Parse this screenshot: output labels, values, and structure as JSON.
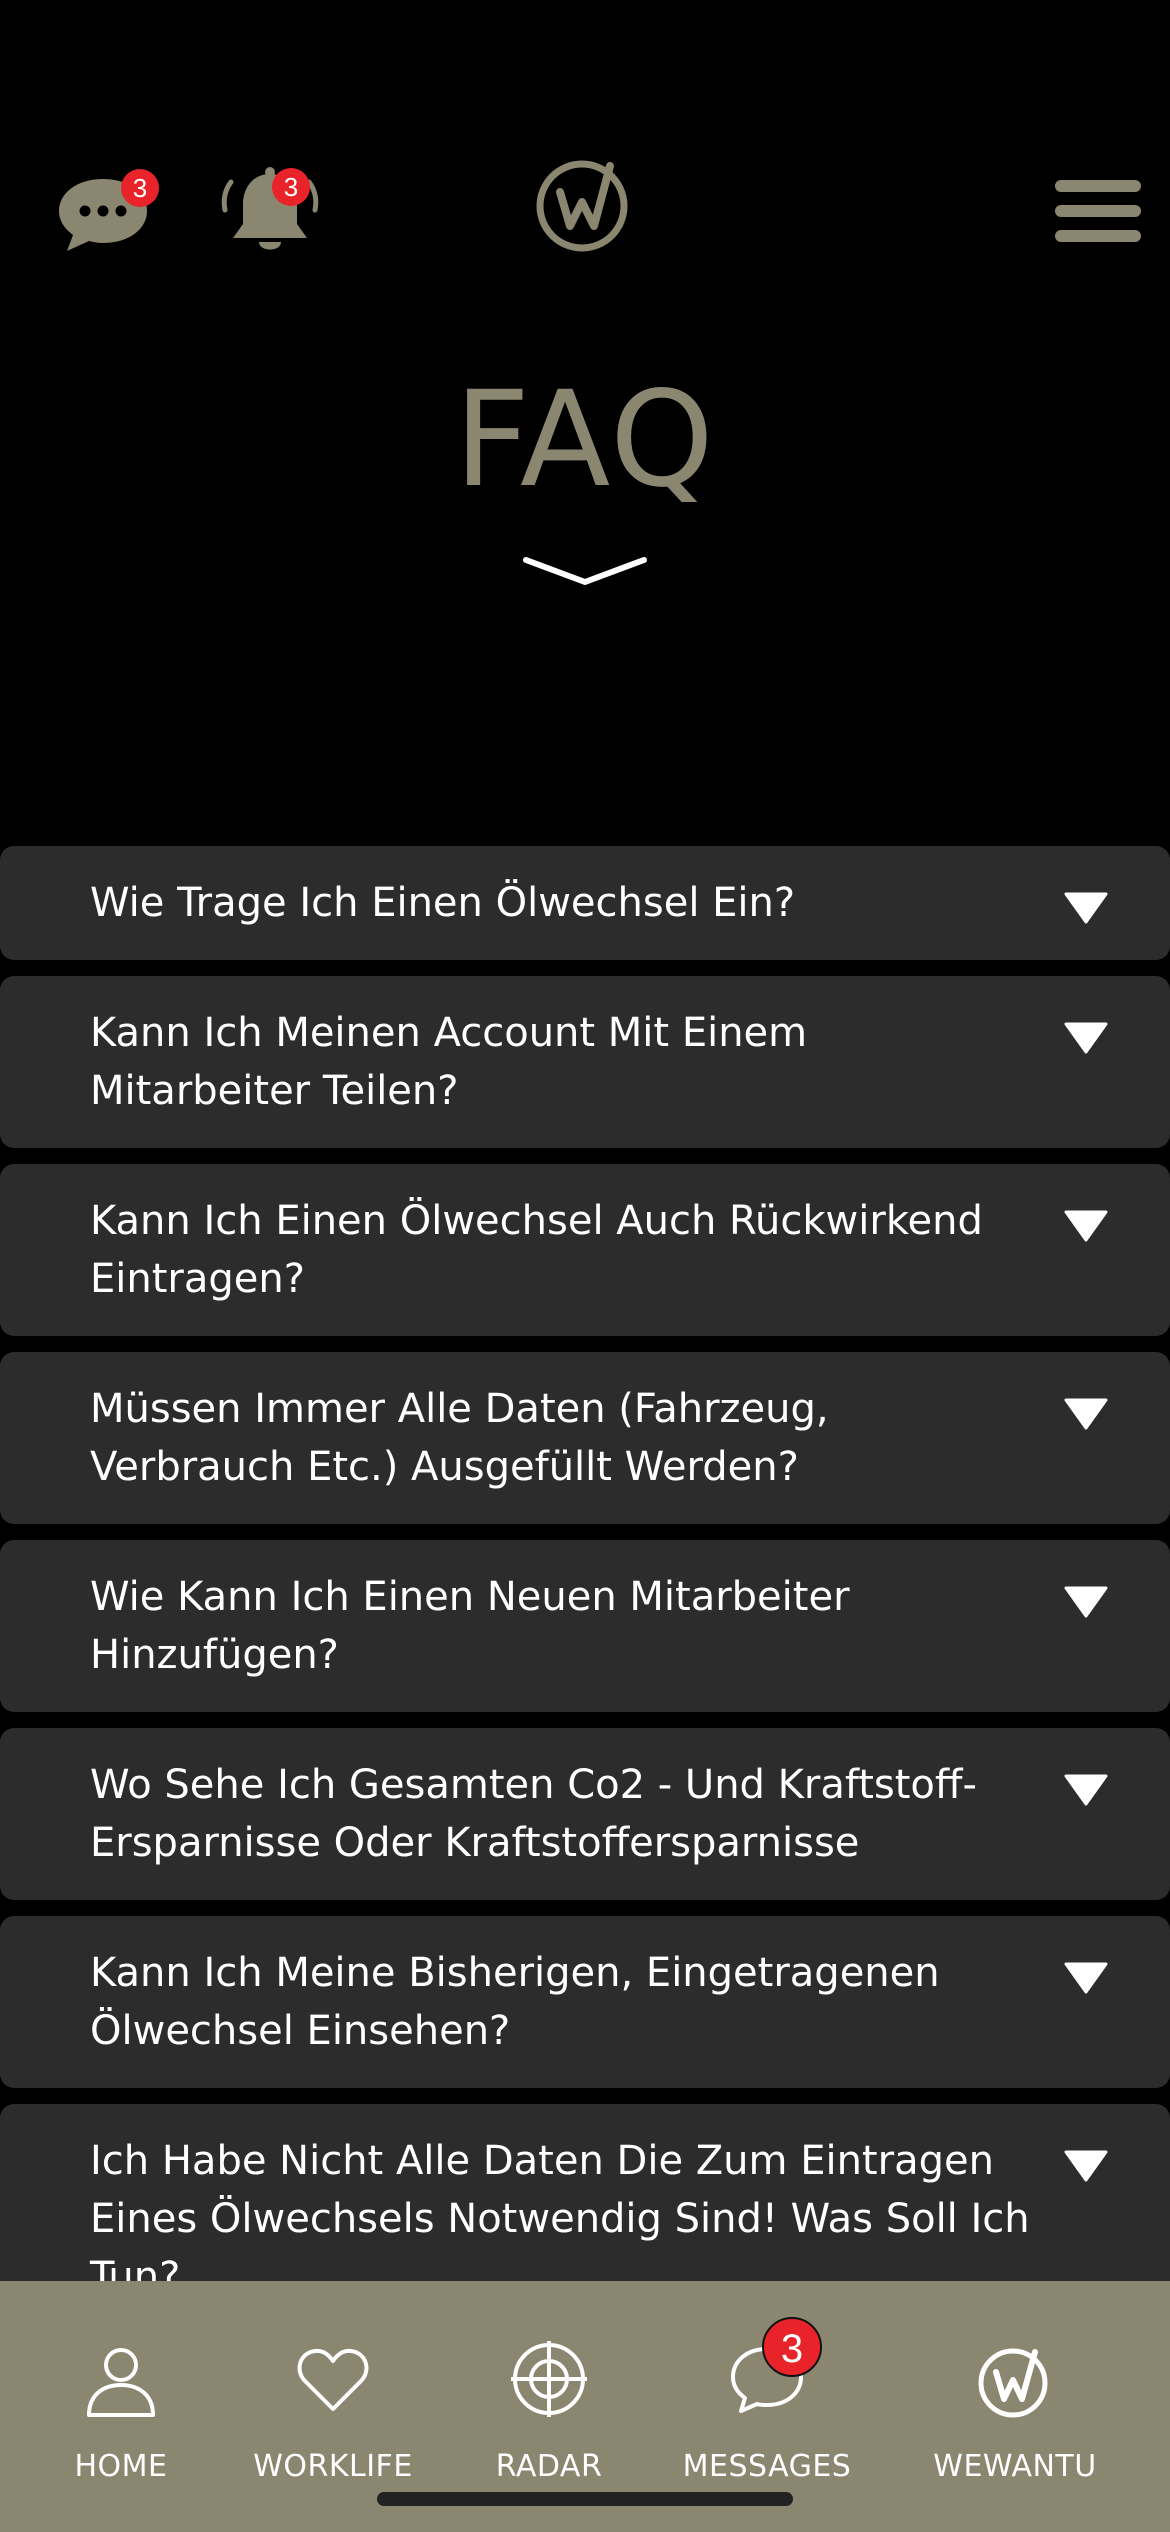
{
  "header": {
    "chat_badge": "3",
    "bell_badge": "3",
    "title": "FAQ"
  },
  "faq": {
    "items": [
      {
        "question": "Wie Trage Ich Einen Ölwechsel Ein?"
      },
      {
        "question": "Kann Ich Meinen Account Mit Einem Mitarbeiter Teilen?"
      },
      {
        "question": "Kann Ich Einen Ölwechsel Auch Rückwirkend Eintragen?"
      },
      {
        "question": "Müssen Immer Alle Daten (Fahrzeug, Verbrauch Etc.) Ausgefüllt Werden?"
      },
      {
        "question": "Wie Kann Ich Einen Neuen Mitarbeiter Hinzufügen?"
      },
      {
        "question": "Wo Sehe Ich Gesamten Co2 - Und Kraftstoff-Ersparnisse Oder Kraftstoffersparnisse"
      },
      {
        "question": "Kann Ich Meine Bisherigen, Eingetragenen Ölwechsel Einsehen?"
      },
      {
        "question": "Ich Habe Nicht Alle Daten Die Zum Eintragen Eines Ölwechsels Notwendig Sind! Was Soll Ich Tun?"
      }
    ]
  },
  "nav": {
    "home": "HOME",
    "worklife": "WORKLIFE",
    "radar": "RADAR",
    "messages": "MESSAGES",
    "messages_badge": "3",
    "wewantu": "WEWANTU"
  },
  "colors": {
    "accent": "#8b8670",
    "card": "#2c2c2c",
    "badge": "#e8242a"
  }
}
